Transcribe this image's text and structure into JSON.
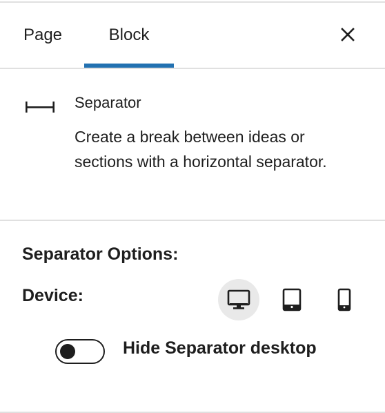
{
  "tabs": [
    {
      "label": "Page"
    },
    {
      "label": "Block"
    }
  ],
  "active_tab": "Block",
  "accent_color": "#2271b1",
  "close_icon": "close-icon",
  "block": {
    "icon": "separator-icon",
    "title": "Separator",
    "description": "Create a break between ideas or sections with a horizontal separator."
  },
  "options": {
    "title": "Separator Options:",
    "device_label": "Device:",
    "devices": [
      {
        "name": "desktop",
        "icon": "desktop-icon",
        "selected": true
      },
      {
        "name": "tablet",
        "icon": "tablet-icon",
        "selected": false
      },
      {
        "name": "mobile",
        "icon": "mobile-icon",
        "selected": false
      }
    ],
    "toggle_label": "Hide Separator desktop",
    "toggle_on": false
  }
}
